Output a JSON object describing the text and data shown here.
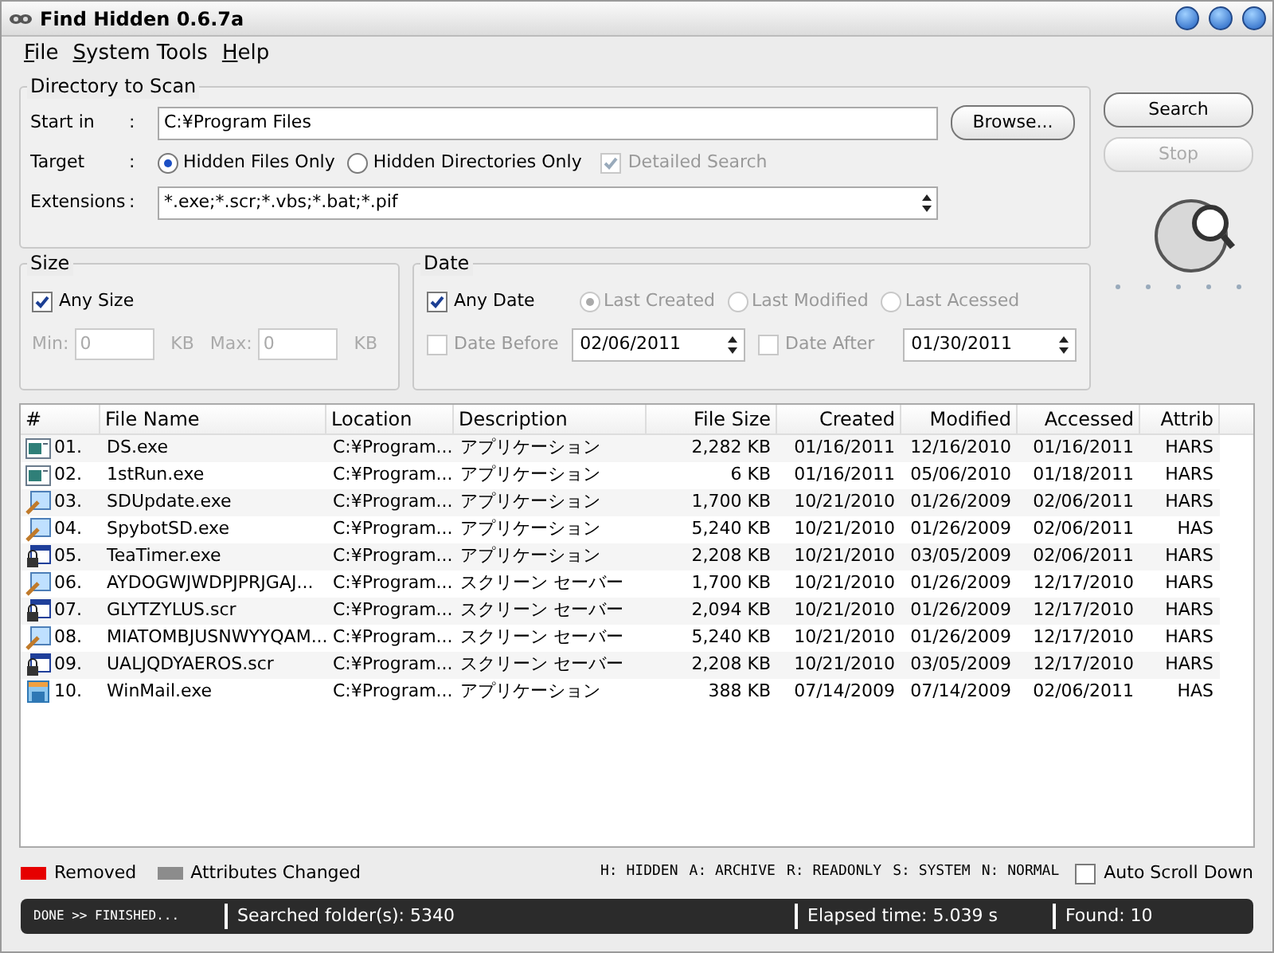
{
  "window": {
    "title": "Find Hidden 0.6.7a"
  },
  "menu": [
    "File",
    "System Tools",
    "Help"
  ],
  "directory": {
    "title": "Directory to Scan",
    "start": {
      "label": "Start in",
      "colon": ":",
      "value": "C:¥Program Files"
    },
    "browse": "Browse...",
    "target": {
      "label": "Target",
      "colon": ":"
    },
    "targets": [
      {
        "label": "Hidden Files Only",
        "selected": true
      },
      {
        "label": "Hidden Directories Only",
        "selected": false
      }
    ],
    "detailed": {
      "label": "Detailed Search",
      "checked": true,
      "disabled": true
    },
    "extensions": {
      "label": "Extensions",
      "colon": ":",
      "value": "*.exe;*.scr;*.vbs;*.bat;*.pif"
    }
  },
  "actions": [
    {
      "label": "Search",
      "disabled": false
    },
    {
      "label": "Stop",
      "disabled": true
    }
  ],
  "size": {
    "title": "Size",
    "any": {
      "label": "Any Size",
      "checked": true
    },
    "disabled": true,
    "fields": [
      {
        "label": "Min:",
        "value": "0",
        "unit": "KB"
      },
      {
        "label": "Max:",
        "value": "0",
        "unit": "KB"
      }
    ]
  },
  "date": {
    "title": "Date",
    "any": {
      "label": "Any Date",
      "checked": true
    },
    "disabled": true,
    "options": [
      {
        "label": "Last Created",
        "selected": true
      },
      {
        "label": "Last Modified",
        "selected": false
      },
      {
        "label": "Last Acessed",
        "selected": false
      }
    ],
    "limits": [
      {
        "label": "Date Before",
        "checked": false,
        "value": "02/06/2011"
      },
      {
        "label": "Date After",
        "checked": false,
        "value": "01/30/2011"
      }
    ]
  },
  "table": {
    "columns": [
      {
        "label": "#"
      },
      {
        "label": "File Name"
      },
      {
        "label": "Location"
      },
      {
        "label": "Description"
      },
      {
        "label": "File Size"
      },
      {
        "label": "Created"
      },
      {
        "label": "Modified"
      },
      {
        "label": "Accessed"
      },
      {
        "label": "Attrib"
      }
    ],
    "rows": [
      {
        "kind": "app",
        "cells": [
          "01.",
          "DS.exe",
          "C:¥Program...",
          "アプリケーション",
          "2,282 KB",
          "01/16/2011",
          "12/16/2010",
          "01/16/2011",
          "HARS"
        ]
      },
      {
        "kind": "app",
        "cells": [
          "02.",
          "1stRun.exe",
          "C:¥Program...",
          "アプリケーション",
          "6 KB",
          "01/16/2011",
          "05/06/2010",
          "01/18/2011",
          "HARS"
        ]
      },
      {
        "kind": "tool",
        "cells": [
          "03.",
          "SDUpdate.exe",
          "C:¥Program...",
          "アプリケーション",
          "1,700 KB",
          "10/21/2010",
          "01/26/2009",
          "02/06/2011",
          "HARS"
        ]
      },
      {
        "kind": "tool",
        "cells": [
          "04.",
          "SpybotSD.exe",
          "C:¥Program...",
          "アプリケーション",
          "5,240 KB",
          "10/21/2010",
          "01/26/2009",
          "02/06/2011",
          "HAS"
        ]
      },
      {
        "kind": "locked",
        "cells": [
          "05.",
          "TeaTimer.exe",
          "C:¥Program...",
          "アプリケーション",
          "2,208 KB",
          "10/21/2010",
          "03/05/2009",
          "02/06/2011",
          "HARS"
        ]
      },
      {
        "kind": "tool",
        "cells": [
          "06.",
          "AYDOGWJWDPJPRJGAJ...",
          "C:¥Program...",
          "スクリーン セーバー",
          "1,700 KB",
          "10/21/2010",
          "01/26/2009",
          "12/17/2010",
          "HARS"
        ]
      },
      {
        "kind": "locked",
        "cells": [
          "07.",
          "GLYTZYLUS.scr",
          "C:¥Program...",
          "スクリーン セーバー",
          "2,094 KB",
          "10/21/2010",
          "01/26/2009",
          "12/17/2010",
          "HARS"
        ]
      },
      {
        "kind": "tool",
        "cells": [
          "08.",
          "MIATOMBJUSNWYYQAM...",
          "C:¥Program...",
          "スクリーン セーバー",
          "5,240 KB",
          "10/21/2010",
          "01/26/2009",
          "12/17/2010",
          "HARS"
        ]
      },
      {
        "kind": "locked",
        "cells": [
          "09.",
          "UALJQDYAEROS.scr",
          "C:¥Program...",
          "スクリーン セーバー",
          "2,208 KB",
          "10/21/2010",
          "03/05/2009",
          "12/17/2010",
          "HARS"
        ]
      },
      {
        "kind": "mail",
        "cells": [
          "10.",
          "WinMail.exe",
          "C:¥Program...",
          "アプリケーション",
          "388 KB",
          "07/14/2009",
          "07/14/2009",
          "02/06/2011",
          "HAS"
        ]
      }
    ]
  },
  "legend": [
    {
      "label": "Removed",
      "color": "#e60000"
    },
    {
      "label": "Attributes Changed",
      "color": "#8c8c8c"
    }
  ],
  "attribute_key": [
    "H: HIDDEN",
    "A: ARCHIVE",
    "R: READONLY",
    "S: SYSTEM",
    "N: NORMAL"
  ],
  "auto_scroll": {
    "label": "Auto Scroll Down",
    "checked": false
  },
  "status": [
    "DONE >> FINISHED...",
    "Searched folder(s): 5340",
    "Elapsed time: 5.039 s",
    "Found:  10"
  ]
}
